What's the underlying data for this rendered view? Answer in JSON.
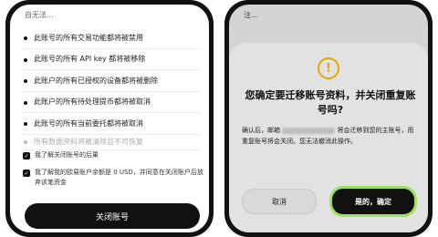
{
  "left": {
    "title": "自无法...",
    "bullets": [
      "此账号的所有交易功能都将被禁用",
      "此账号的所有 API key 都将被移除",
      "此账户的所有已授权的设备都将被删除",
      "此账户的所有待处理提币都将被取消",
      "此账号的所有当前委托都将被取消",
      "所有数据资料将被清除且不可恢复"
    ],
    "checks": [
      "我了解关闭账号的后果",
      "我了解我的欧易账户余额是 0 USD，并同意在关闭账户后放弃该笔资金"
    ],
    "close_button": "关闭账号"
  },
  "right": {
    "title": "注...",
    "dialog_title": "您确定要迁移账号资料，并关闭重复账号吗?",
    "body_before": "确认后，邮箱",
    "body_after": "将会迁移到您的主账号，而重复账号将会关闭。您无法撤消此操作。",
    "cancel_button": "取消",
    "confirm_button": "是的，确定"
  },
  "colors": {
    "accent_border": "#9be15d",
    "warning": "#e5a800"
  },
  "icons": {
    "checkbox": "check-icon",
    "warning": "exclamation-warning-icon"
  }
}
